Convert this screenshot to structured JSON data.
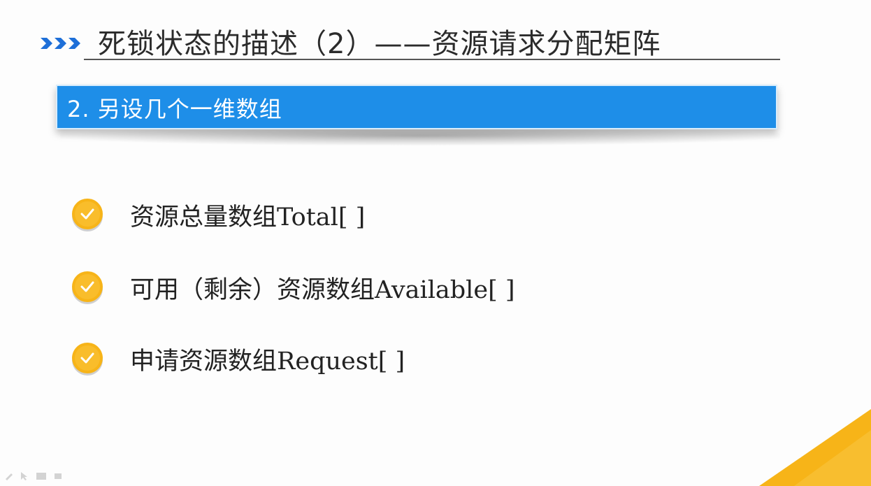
{
  "slide": {
    "title": "死锁状态的描述（2）——资源请求分配矩阵",
    "banner": "2.  另设几个一维数组",
    "items": [
      {
        "label": "资源总量数组Total[ ]",
        "icon": "check-icon"
      },
      {
        "label": "可用（剩余）资源数组Available[ ]",
        "icon": "check-icon"
      },
      {
        "label": "申请资源数组Request[ ]",
        "icon": "check-icon"
      }
    ]
  },
  "colors": {
    "banner": "#1e8ee8",
    "title_arrows": "#1e6fd8",
    "check_circle": "#f7b418",
    "corner": "#f7b418"
  }
}
